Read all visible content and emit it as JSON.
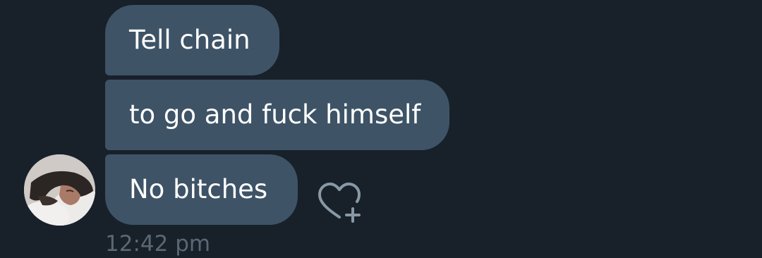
{
  "conversation": {
    "messages": [
      {
        "text": "Tell chain"
      },
      {
        "text": "to go and fuck himself"
      },
      {
        "text": "No bitches"
      }
    ],
    "timestamp": "12:42 pm",
    "reaction_icon": "heart-plus-icon",
    "avatar_icon": "profile-photo"
  },
  "colors": {
    "background": "#18202a",
    "bubble": "#3e5366",
    "text": "#ffffff",
    "timestamp": "#5b6773",
    "icon": "#8899a6"
  }
}
